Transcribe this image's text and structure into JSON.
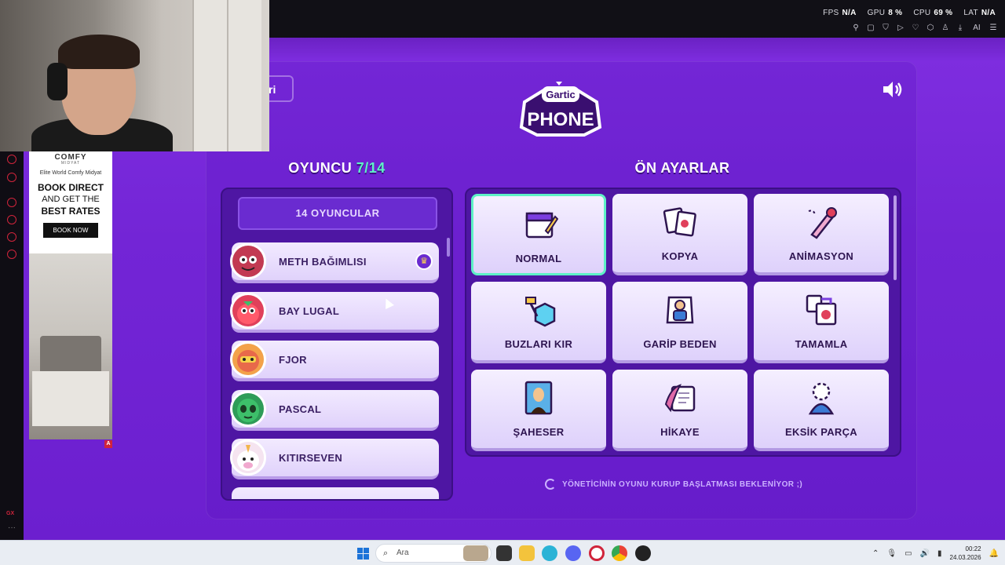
{
  "browser": {
    "stats": [
      {
        "label": "FPS",
        "value": "N/A"
      },
      {
        "label": "GPU",
        "value": "8 %"
      },
      {
        "label": "CPU",
        "value": "69 %"
      },
      {
        "label": "LAT",
        "value": "N/A"
      }
    ],
    "toolbar_icons": [
      "pin-icon",
      "snapshot-icon",
      "shield-icon",
      "play-icon",
      "heart-icon",
      "extensions-icon",
      "profile-icon",
      "download-icon",
      "ai-icon",
      "menu-icon"
    ],
    "ai_label": "AI"
  },
  "sidebar": {
    "gx_label": "GX",
    "more_label": "···"
  },
  "ad": {
    "brand": "COMFY",
    "brand_sub": "MIDYAT",
    "hotel": "Elite World Comfy Midyat",
    "line1": "BOOK DIRECT",
    "line2": "AND GET THE",
    "line3": "BEST RATES",
    "cta": "BOOK NOW",
    "badge": "A"
  },
  "game": {
    "back_label": "ri",
    "logo_top": "Gartic",
    "logo_bottom": "PHONE",
    "players_title_prefix": "OYUNCU",
    "players_title_value": "7/14",
    "presets_title": "ÖN AYARLAR",
    "players_count_label": "14 OYUNCULAR",
    "players": [
      {
        "name": "METH BAĞIMLISI",
        "host": true,
        "color": "#c23a52"
      },
      {
        "name": "BAY LUGAL",
        "host": false,
        "color": "#e0405a"
      },
      {
        "name": "FJOR",
        "host": false,
        "color": "#e8694a"
      },
      {
        "name": "PASCAL",
        "host": false,
        "color": "#3dbf6a"
      },
      {
        "name": "KITIRSEVEN",
        "host": false,
        "color": "#f1c9e3"
      }
    ],
    "presets": [
      {
        "label": "NORMAL",
        "icon": "calendar-pencil-icon",
        "selected": true
      },
      {
        "label": "KOPYA",
        "icon": "cards-icon",
        "selected": false
      },
      {
        "label": "ANİMASYON",
        "icon": "pencil-icon",
        "selected": false
      },
      {
        "label": "BUZLARI KIR",
        "icon": "ice-hammer-icon",
        "selected": false
      },
      {
        "label": "GARİP BEDEN",
        "icon": "body-puzzle-icon",
        "selected": false
      },
      {
        "label": "TAMAMLA",
        "icon": "puzzle-icon",
        "selected": false
      },
      {
        "label": "ŞAHESER",
        "icon": "mona-lisa-icon",
        "selected": false
      },
      {
        "label": "HİKAYE",
        "icon": "scroll-feather-icon",
        "selected": false
      },
      {
        "label": "EKSİK PARÇA",
        "icon": "missing-piece-icon",
        "selected": false
      }
    ],
    "waiting_text": "YÖNETİCİNİN OYUNU KURUP BAŞLATMASI BEKLENİYOR ;)"
  },
  "taskbar": {
    "search_placeholder": "Ara",
    "time": "00:22",
    "date": "24.03.2026"
  }
}
